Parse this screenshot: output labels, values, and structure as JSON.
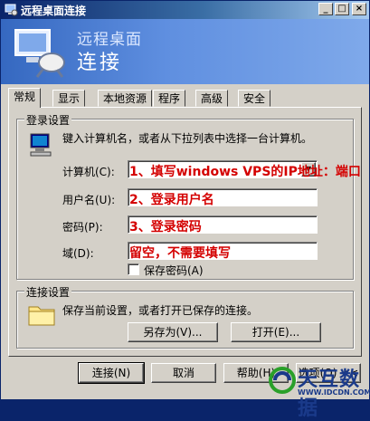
{
  "window": {
    "title": "远程桌面连接",
    "controls": {
      "minimize": "_",
      "maximize": "□",
      "close": "×"
    }
  },
  "banner": {
    "subtitle": "远程桌面",
    "title": "连接"
  },
  "tabs": [
    {
      "label": "常规",
      "active": true
    },
    {
      "label": "显示"
    },
    {
      "label": "本地资源"
    },
    {
      "label": "程序"
    },
    {
      "label": "高级"
    },
    {
      "label": "安全"
    }
  ],
  "login": {
    "legend": "登录设置",
    "description": "键入计算机名，或者从下拉列表中选择一台计算机。",
    "computer_label": "计算机(C):",
    "username_label": "用户名(U):",
    "password_label": "密码(P):",
    "domain_label": "域(D):",
    "save_password_label": "保存密码(A)",
    "save_password_checked": false,
    "annotations": {
      "computer": "1、填写windows VPS的IP地址：端口",
      "username": "2、登录用户名",
      "password": "3、登录密码",
      "domain": "留空，不需要填写"
    }
  },
  "connection": {
    "legend": "连接设置",
    "description": "保存当前设置，或者打开已保存的连接。",
    "save_as_label": "另存为(V)...",
    "open_label": "打开(E)..."
  },
  "footer": {
    "connect_label": "连接(N)",
    "cancel_label": "取消",
    "help_label": "帮助(H)",
    "options_label": "选项(O) <<"
  },
  "watermark": {
    "name": "天互数据",
    "url": "WWW.IDCDN.COM"
  },
  "colors": {
    "title_bar": "#0a246a",
    "banner": "#5f8fe0",
    "annotation": "#d40000",
    "face": "#d4d0c8"
  }
}
